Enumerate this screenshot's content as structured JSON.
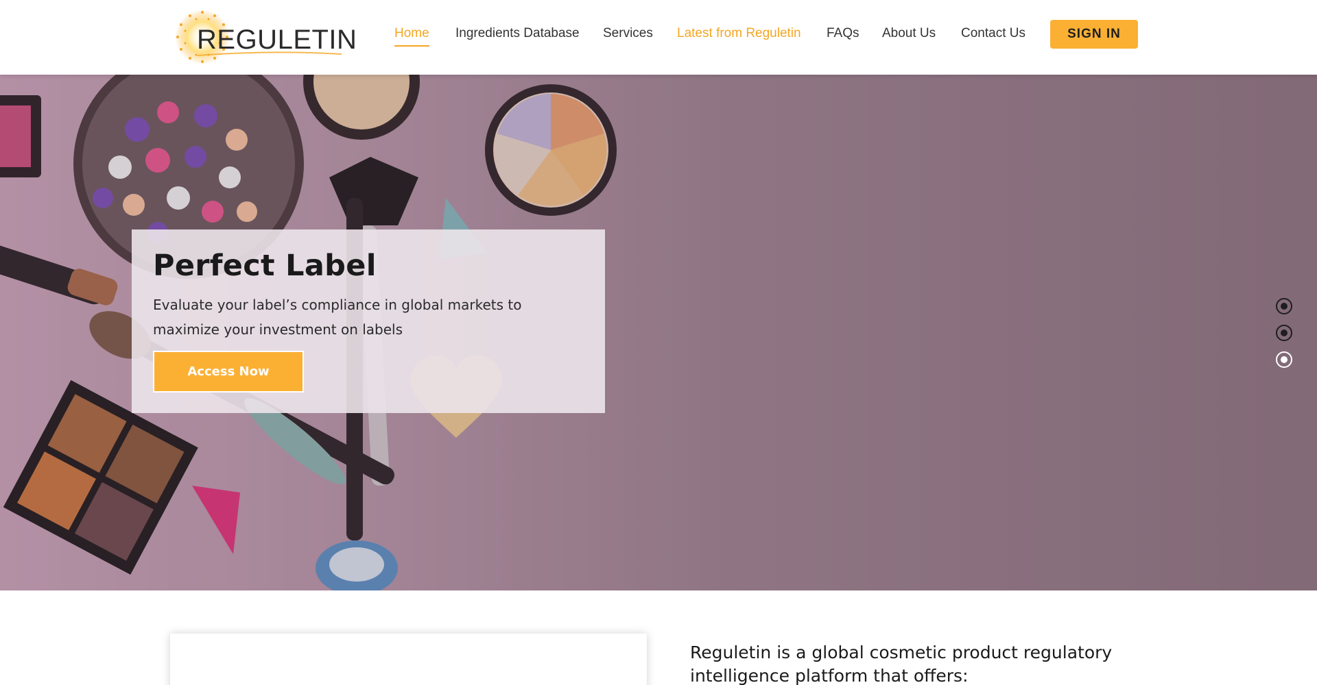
{
  "header": {
    "logo_text": "REGULETIN",
    "nav": [
      {
        "label": "Home",
        "active": true
      },
      {
        "label": "Ingredients Database"
      },
      {
        "label": "Services"
      },
      {
        "label": "Latest from Reguletin",
        "highlight": true
      },
      {
        "label": "FAQs"
      },
      {
        "label": "About Us"
      },
      {
        "label": "Contact Us"
      }
    ],
    "signin_label": "SIGN IN"
  },
  "hero": {
    "title": "Perfect Label",
    "description": "Evaluate your label’s compliance in global markets to maximize your investment on labels",
    "cta_label": "Access Now",
    "slides": 3,
    "active_slide": 3
  },
  "intro": {
    "text": "Reguletin is a global cosmetic product regulatory intelligence platform that offers:"
  },
  "colors": {
    "accent": "#fbb034",
    "nav_highlight": "#f5a623",
    "text": "#333333"
  },
  "icons": [
    "sun-logo-icon",
    "carousel-dot-icon"
  ]
}
